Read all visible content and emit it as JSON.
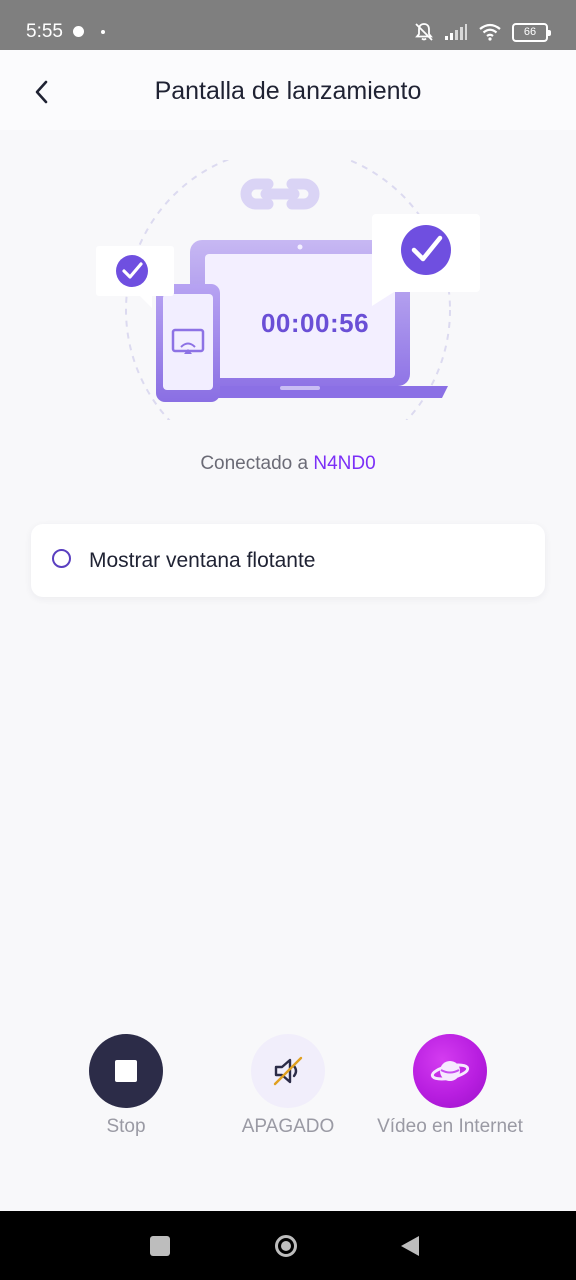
{
  "status_bar": {
    "time": "5:55",
    "battery": "66"
  },
  "header": {
    "title": "Pantalla de lanzamiento"
  },
  "illustration": {
    "timer": "00:00:56"
  },
  "connection": {
    "prefix": "Conectado a",
    "device_name": "N4ND0"
  },
  "floating_window_option": {
    "label": "Mostrar ventana flotante",
    "checked": false
  },
  "actions": {
    "stop_label": "Stop",
    "mute_label": "APAGADO",
    "web_video_label": "Vídeo en Internet"
  },
  "colors": {
    "accent": "#7b2ff7",
    "timer": "#6a4fd6",
    "stop_button": "#2c2c48",
    "web_button": "#b81ee0"
  }
}
